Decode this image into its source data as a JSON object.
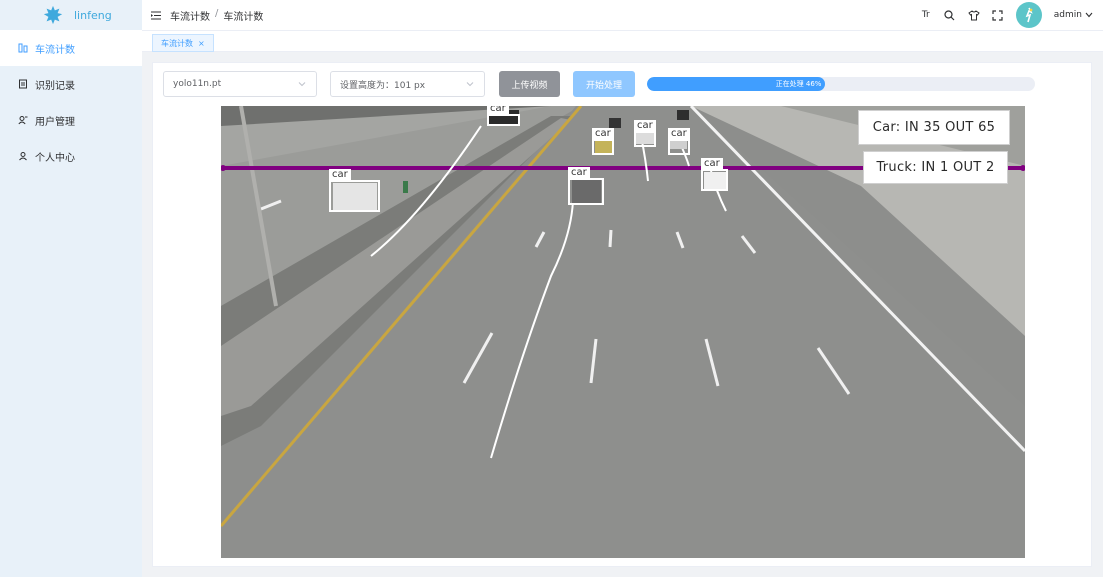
{
  "brand": {
    "name": "linfeng",
    "accent": "#3fa9dd"
  },
  "sidebar": {
    "items": [
      {
        "label": "车流计数",
        "icon": "vehicle-icon",
        "active": true
      },
      {
        "label": "识别记录",
        "icon": "record-icon",
        "active": false
      },
      {
        "label": "用户管理",
        "icon": "users-icon",
        "active": false
      },
      {
        "label": "个人中心",
        "icon": "user-icon",
        "active": false
      }
    ]
  },
  "header": {
    "breadcrumb": [
      "车流计数",
      "车流计数"
    ],
    "separator": "/",
    "font_tool": "Tr",
    "username": "admin"
  },
  "tabs": [
    {
      "label": "车流计数",
      "close": "×"
    }
  ],
  "controls": {
    "model_select": "yolo11n.pt",
    "height_select": "设置高度为：101 px",
    "upload_label": "上传视频",
    "start_label": "开始处理",
    "progress_text": "正在处理 46%",
    "progress_value": 46
  },
  "video": {
    "counts": {
      "car": "Car: IN 35 OUT 65",
      "truck": "Truck: IN 1 OUT 2"
    },
    "detection_label": "car",
    "detections": [
      "car",
      "car",
      "car",
      "car",
      "car",
      "car"
    ]
  },
  "colors": {
    "primary": "#409eff",
    "sidebar_bg": "#e8f1f9",
    "counting_line": "#800080",
    "upload_btn": "#909399",
    "start_btn": "#8fc7ff"
  }
}
